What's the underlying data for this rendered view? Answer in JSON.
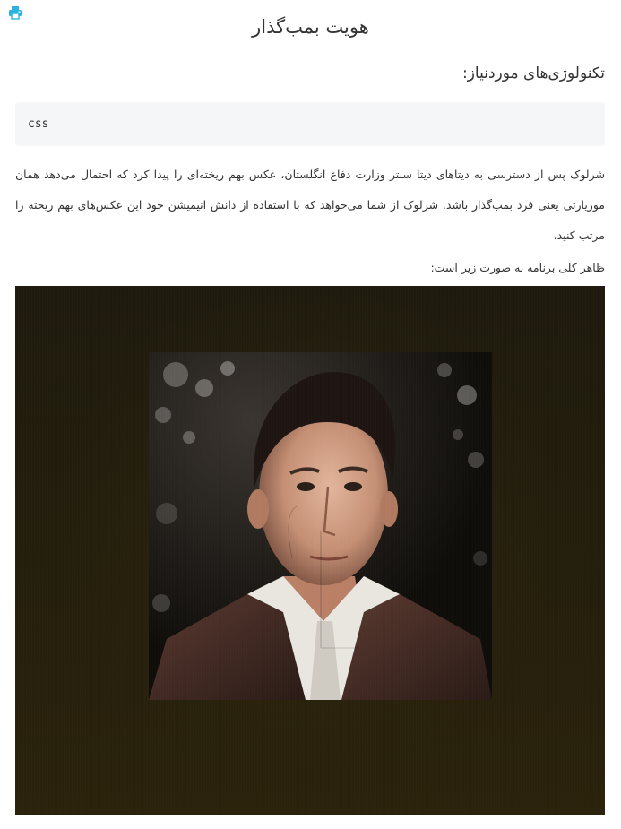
{
  "toolbar": {
    "print_icon": "printer-icon",
    "accent_color": "#2bb3e0"
  },
  "page": {
    "title": "هویت بمب‌گذار",
    "tech_heading": "تکنولوژی‌های موردنیاز:",
    "tech_value": "css",
    "description": "شرلوک پس از دسترسی به دیتاهای دیتا سنتر وزارت دفاع انگلستان، عکس بهم ریخته‌ای را پیدا کرد که احتمال می‌دهد همان موریارتی یعنی فرد بمب‌گذار باشد. شرلوک از شما می‌خواهد که با استفاده از دانش انیمیشن خود این عکس‌های بهم ریخته را مرتب کنید.",
    "overview_text": "ظاهر کلی برنامه به صورت زیر است:"
  },
  "stage": {
    "background_color": "#241e0c",
    "image_subject": "portrait-photo"
  }
}
